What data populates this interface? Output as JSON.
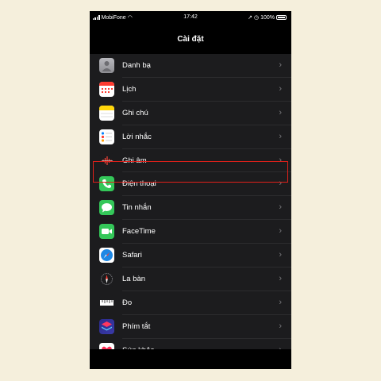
{
  "status": {
    "carrier": "MobiFone",
    "time": "17:42",
    "battery": "100%"
  },
  "header": {
    "title": "Cài đặt"
  },
  "items": [
    {
      "label": "Danh bạ",
      "icon": "contacts-icon",
      "color": "#8e8e93"
    },
    {
      "label": "Lịch",
      "icon": "calendar-icon",
      "color": "#ffffff"
    },
    {
      "label": "Ghi chú",
      "icon": "notes-icon",
      "color": "#ffd60a"
    },
    {
      "label": "Lời nhắc",
      "icon": "reminders-icon",
      "color": "#ffffff"
    },
    {
      "label": "Ghi âm",
      "icon": "voice-memos-icon",
      "color": "#1c1c1e"
    },
    {
      "label": "Điện thoại",
      "icon": "phone-icon",
      "color": "#34c759"
    },
    {
      "label": "Tin nhắn",
      "icon": "messages-icon",
      "color": "#34c759"
    },
    {
      "label": "FaceTime",
      "icon": "facetime-icon",
      "color": "#34c759"
    },
    {
      "label": "Safari",
      "icon": "safari-icon",
      "color": "#1e88e5"
    },
    {
      "label": "La bàn",
      "icon": "compass-icon",
      "color": "#1c1c1e"
    },
    {
      "label": "Đo",
      "icon": "measure-icon",
      "color": "#1c1c1e"
    },
    {
      "label": "Phím tắt",
      "icon": "shortcuts-icon",
      "color": "#3a3aa8"
    },
    {
      "label": "Sức khỏe",
      "icon": "health-icon",
      "color": "#ffffff"
    }
  ],
  "highlight_color": "#e0201a"
}
